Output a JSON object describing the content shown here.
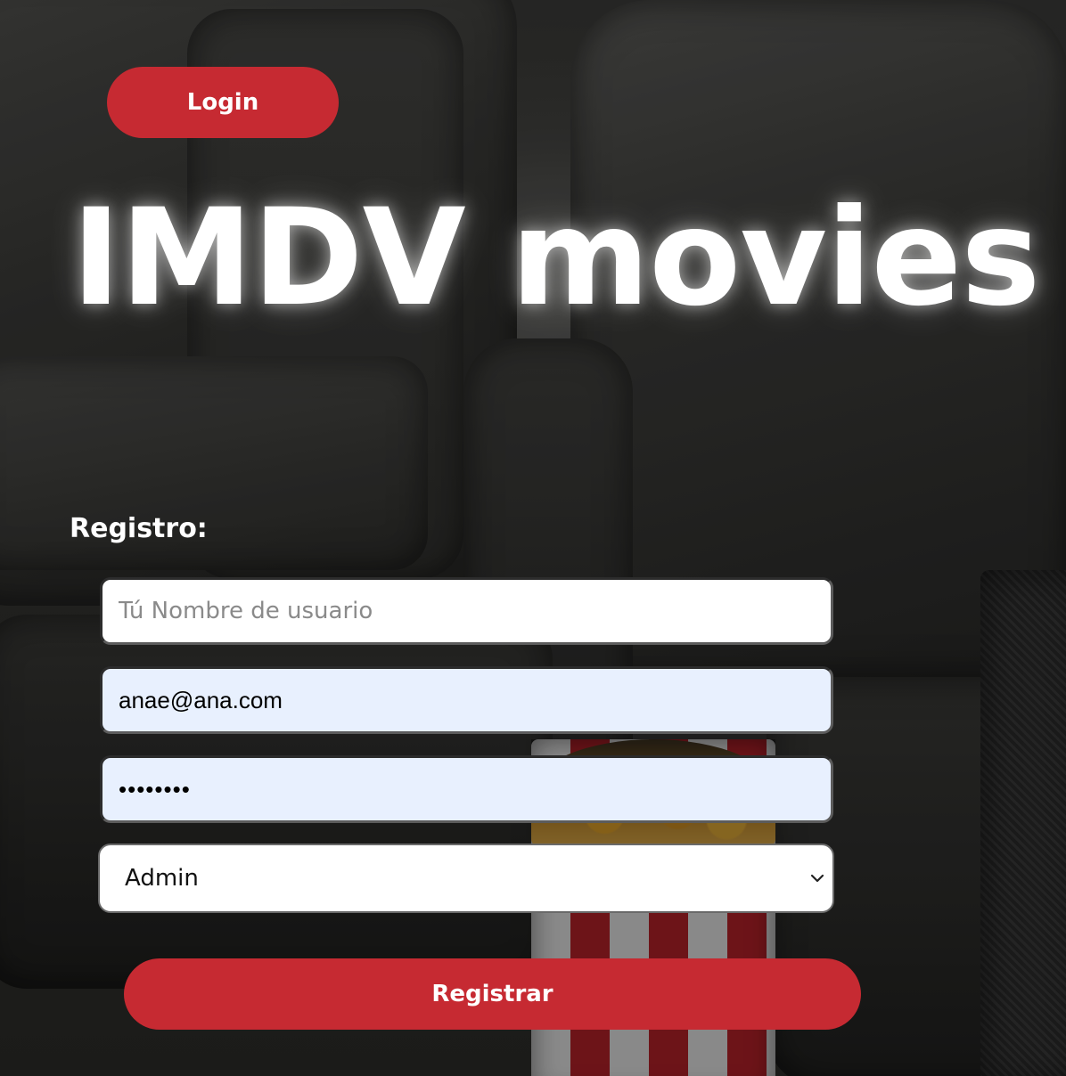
{
  "header": {
    "login_label": "Login",
    "app_title": "IMDV movies"
  },
  "register_form": {
    "heading": "Registro:",
    "username": {
      "placeholder": "Tú Nombre de usuario",
      "value": ""
    },
    "email": {
      "value": "anae@ana.com"
    },
    "password": {
      "value": "••••••••"
    },
    "role": {
      "selected": "Admin",
      "icon": "chevron-down-icon"
    },
    "submit_label": "Registrar"
  },
  "colors": {
    "accent": "#c62a32",
    "autofill_background": "#e8f0fe",
    "title_text": "#ffffff"
  }
}
